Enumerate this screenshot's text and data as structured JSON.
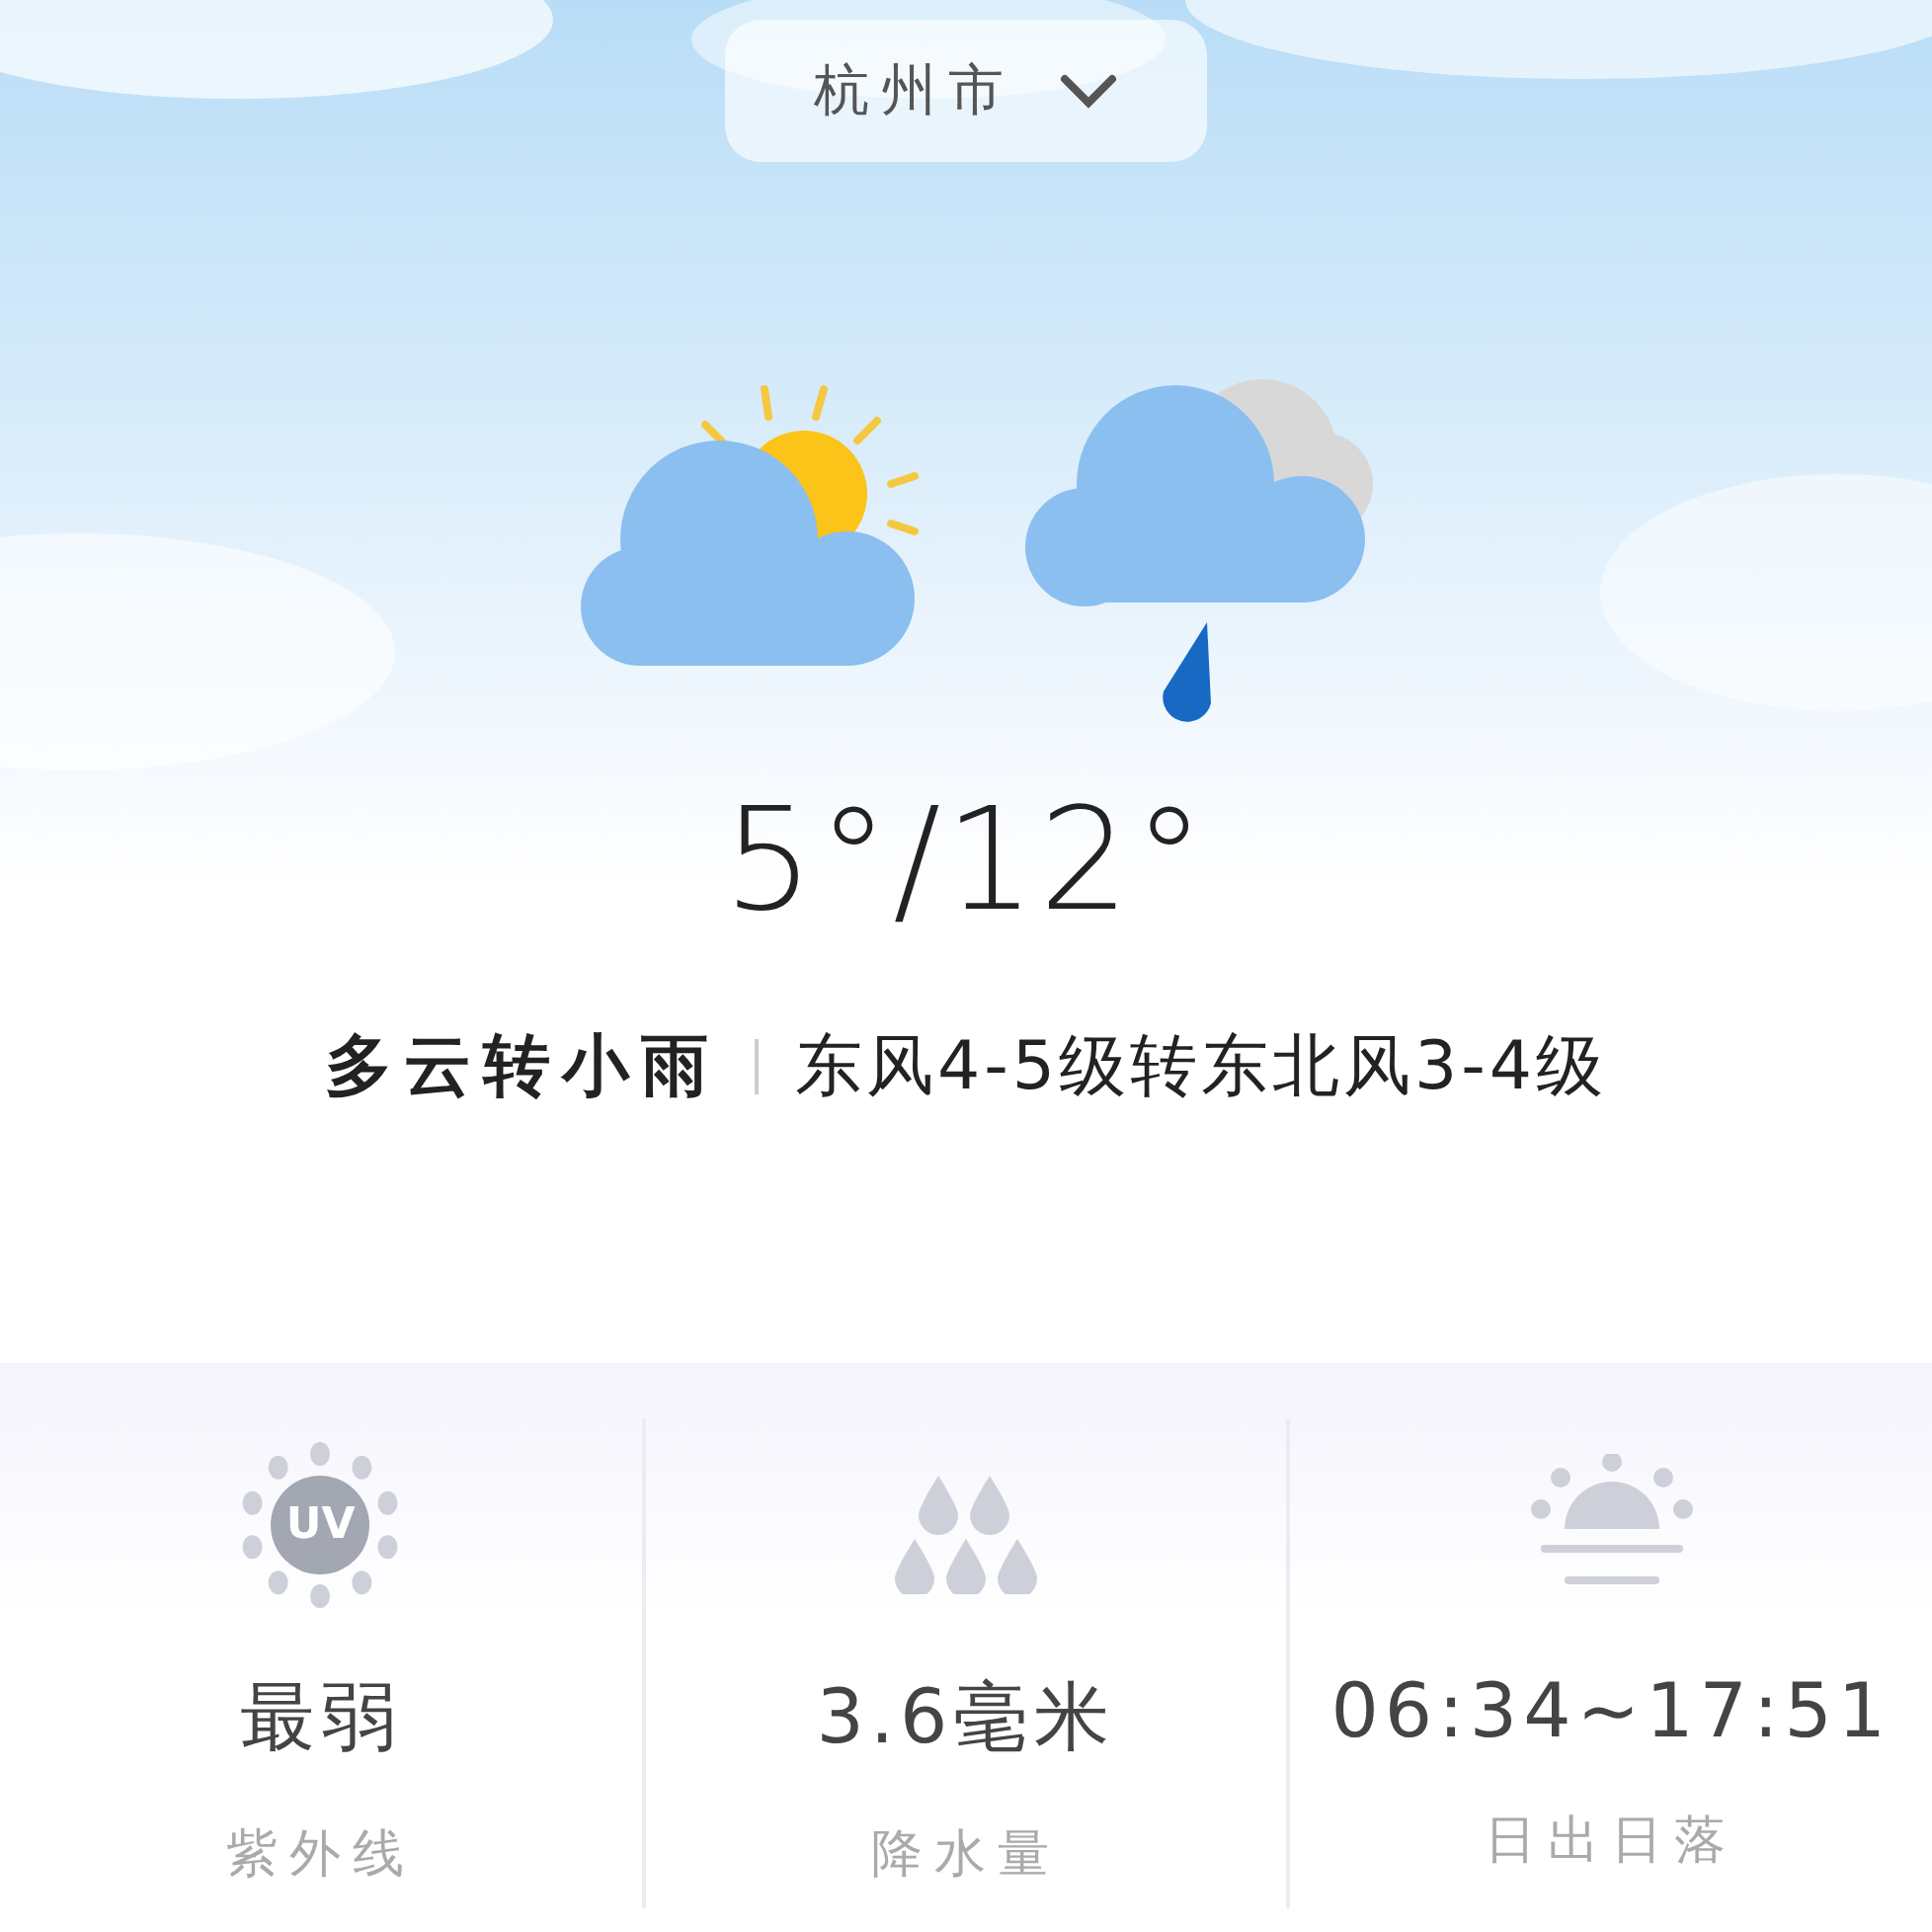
{
  "city_selector": {
    "label": "杭州市"
  },
  "forecast": {
    "icons": [
      {
        "kind": "partly_cloudy"
      },
      {
        "kind": "rain"
      }
    ],
    "temperature": "5°/12°",
    "condition": "多云转小雨",
    "wind": "东风4-5级转东北风3-4级"
  },
  "details": [
    {
      "kind": "uv",
      "icon_text": "UV",
      "value": "最弱",
      "label": "紫外线"
    },
    {
      "kind": "rain",
      "value": "3.6毫米",
      "label": "降水量"
    },
    {
      "kind": "sun",
      "value": "06:34~17:51",
      "label": "日出日落"
    }
  ]
}
